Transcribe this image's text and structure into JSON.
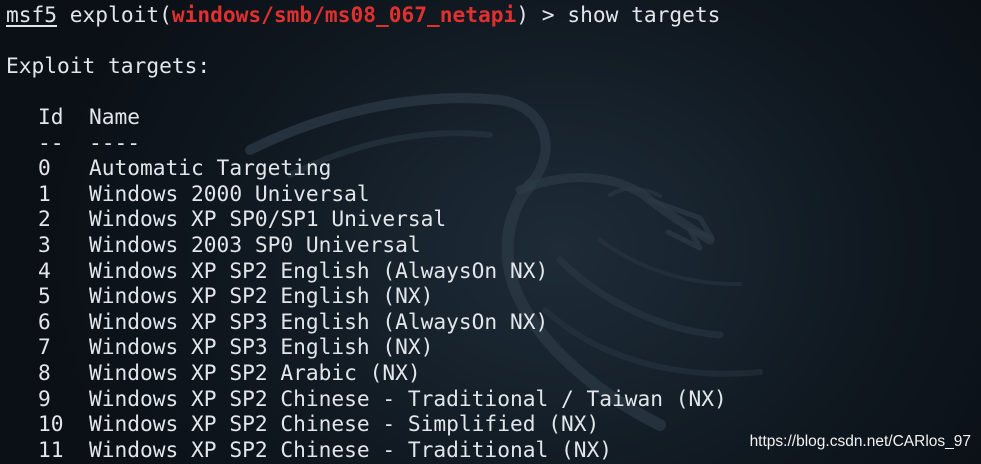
{
  "prompt": {
    "console": "msf5",
    "command_prefix": "exploit(",
    "module": "windows/smb/ms08_067_netapi",
    "command_suffix": ") > ",
    "command": "show targets"
  },
  "section_title": "Exploit targets:",
  "table": {
    "headers": {
      "id": "Id",
      "name": "Name"
    },
    "separators": {
      "id": "--",
      "name": "----"
    },
    "rows": [
      {
        "id": "0",
        "name": "Automatic Targeting"
      },
      {
        "id": "1",
        "name": "Windows 2000 Universal"
      },
      {
        "id": "2",
        "name": "Windows XP SP0/SP1 Universal"
      },
      {
        "id": "3",
        "name": "Windows 2003 SP0 Universal"
      },
      {
        "id": "4",
        "name": "Windows XP SP2 English (AlwaysOn NX)"
      },
      {
        "id": "5",
        "name": "Windows XP SP2 English (NX)"
      },
      {
        "id": "6",
        "name": "Windows XP SP3 English (AlwaysOn NX)"
      },
      {
        "id": "7",
        "name": "Windows XP SP3 English (NX)"
      },
      {
        "id": "8",
        "name": "Windows XP SP2 Arabic (NX)"
      },
      {
        "id": "9",
        "name": "Windows XP SP2 Chinese - Traditional / Taiwan (NX)"
      },
      {
        "id": "10",
        "name": "Windows XP SP2 Chinese - Simplified (NX)"
      },
      {
        "id": "11",
        "name": "Windows XP SP2 Chinese - Traditional (NX)"
      }
    ]
  },
  "watermark": "https://blog.csdn.net/CARlos_97",
  "colors": {
    "background": "#0b1016",
    "text": "#e2e6ea",
    "module_highlight": "#e0302f",
    "watermark_logo": "#2c3a46"
  },
  "icons": {
    "background_logo": "kali-dragon-icon"
  }
}
